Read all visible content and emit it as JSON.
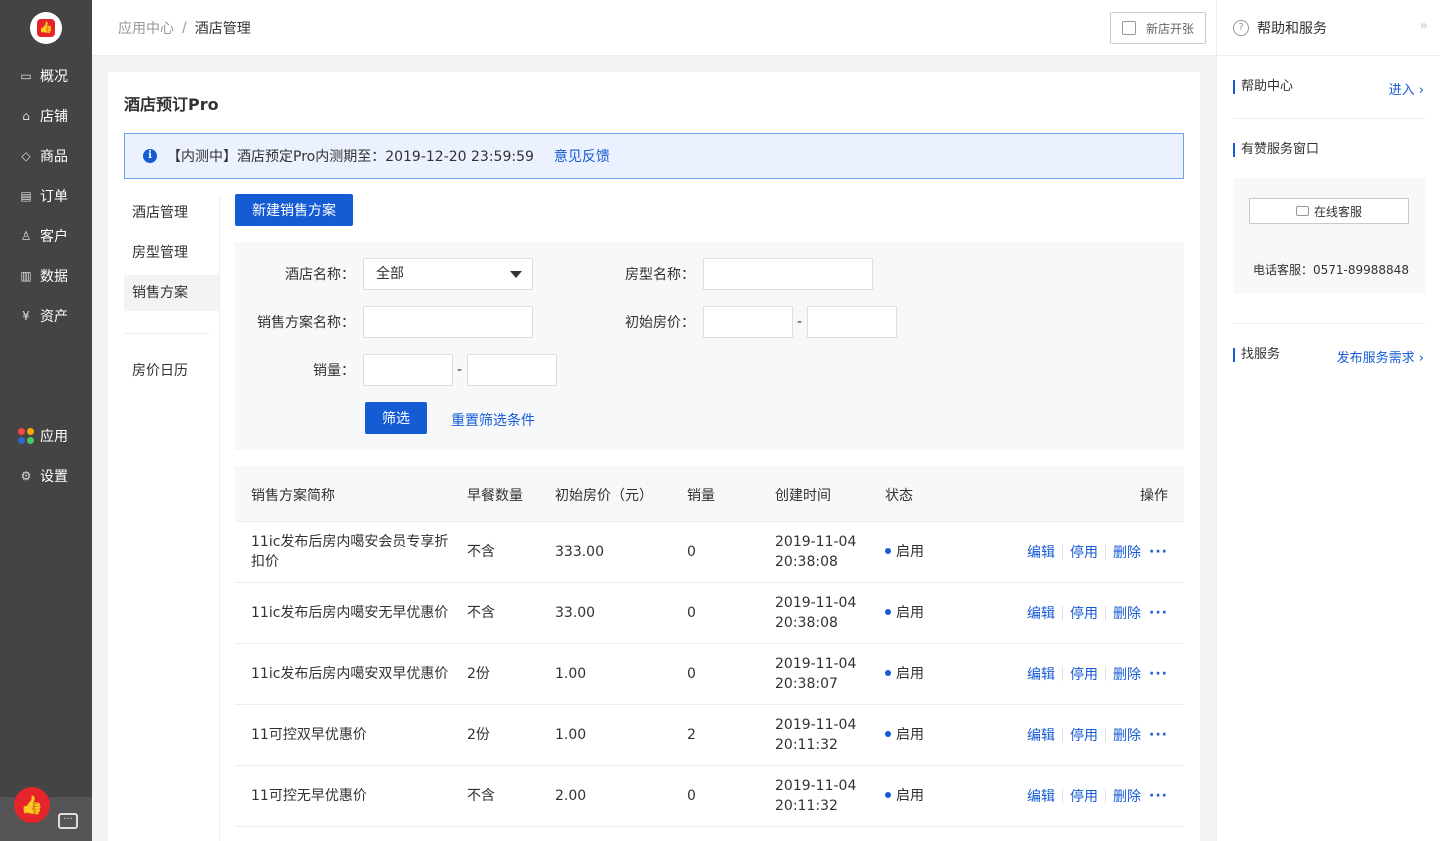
{
  "sidebar": {
    "items": [
      {
        "label": "概况",
        "icon": "overview-icon"
      },
      {
        "label": "店铺",
        "icon": "store-icon"
      },
      {
        "label": "商品",
        "icon": "tag-icon"
      },
      {
        "label": "订单",
        "icon": "order-icon"
      },
      {
        "label": "客户",
        "icon": "user-icon"
      },
      {
        "label": "数据",
        "icon": "chart-icon"
      },
      {
        "label": "资产",
        "icon": "yuan-icon"
      }
    ],
    "bottom_items": [
      {
        "label": "应用",
        "icon": "apps-icon"
      },
      {
        "label": "设置",
        "icon": "gear-icon"
      }
    ],
    "app_icon_colors": [
      "#f44",
      "#fa0",
      "#36c",
      "#4c6"
    ]
  },
  "header": {
    "breadcrumb_root": "应用中心",
    "breadcrumb_sep": "/",
    "breadcrumb_current": "酒店管理",
    "new_store_label": "新店开张"
  },
  "help": {
    "title": "帮助和服务",
    "help_center": "帮助中心",
    "enter": "进入",
    "service_window": "有赞服务窗口",
    "online_service": "在线客服",
    "phone": "电话客服：0571-89988848",
    "find_service": "找服务",
    "publish_request": "发布服务需求"
  },
  "main": {
    "title": "酒店预订Pro",
    "notice_text": "【内测中】酒店预定Pro内测期至：2019-12-20 23:59:59",
    "feedback": "意见反馈",
    "subnav": [
      "酒店管理",
      "房型管理",
      "销售方案"
    ],
    "subnav_extra": "房价日历",
    "create_button": "新建销售方案",
    "filter": {
      "hotel_label": "酒店名称：",
      "hotel_value": "全部",
      "room_label": "房型名称：",
      "plan_label": "销售方案名称：",
      "price_label": "初始房价：",
      "sales_label": "销量：",
      "dash": "-",
      "submit": "筛选",
      "reset": "重置筛选条件"
    },
    "table": {
      "headers": [
        "销售方案简称",
        "早餐数量",
        "初始房价（元）",
        "销量",
        "创建时间",
        "状态",
        "操作"
      ],
      "rows": [
        {
          "name": "11ic发布后房内噶安会员专享折扣价",
          "breakfast": "不含",
          "price": "333.00",
          "sales": "0",
          "date": "2019-11-04",
          "time": "20:38:08",
          "status": "启用"
        },
        {
          "name": "11ic发布后房内噶安无早优惠价",
          "breakfast": "不含",
          "price": "33.00",
          "sales": "0",
          "date": "2019-11-04",
          "time": "20:38:08",
          "status": "启用"
        },
        {
          "name": "11ic发布后房内噶安双早优惠价",
          "breakfast": "2份",
          "price": "1.00",
          "sales": "0",
          "date": "2019-11-04",
          "time": "20:38:07",
          "status": "启用"
        },
        {
          "name": "11可控双早优惠价",
          "breakfast": "2份",
          "price": "1.00",
          "sales": "2",
          "date": "2019-11-04",
          "time": "20:11:32",
          "status": "启用"
        },
        {
          "name": "11可控无早优惠价",
          "breakfast": "不含",
          "price": "2.00",
          "sales": "0",
          "date": "2019-11-04",
          "time": "20:11:32",
          "status": "启用"
        }
      ],
      "ops": {
        "edit": "编辑",
        "disable": "停用",
        "delete": "删除",
        "more": "···"
      }
    }
  },
  "colors": {
    "accent": "#155bd4",
    "sidebar": "#444444",
    "logo_red": "#e5242b"
  }
}
